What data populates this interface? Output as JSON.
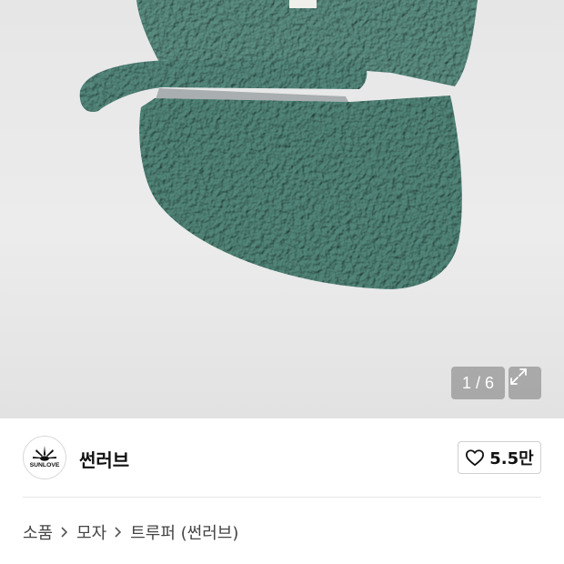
{
  "gallery": {
    "image_alt": "product-image-hat",
    "counter": "1 / 6",
    "expand_icon": "expand-icon"
  },
  "brand": {
    "name": "썬러브",
    "logo_text": "SUNLOVE",
    "like_icon": "heart-icon",
    "like_count": "5.5만"
  },
  "breadcrumb": {
    "items": [
      "소품",
      "모자",
      "트루퍼 (썬러브)"
    ],
    "separator_icon": "chevron-right-icon"
  },
  "colors": {
    "hat": "#8cb3ab",
    "gallery_bg": "#e8e8e8",
    "overlay": "#8a8a8a"
  }
}
